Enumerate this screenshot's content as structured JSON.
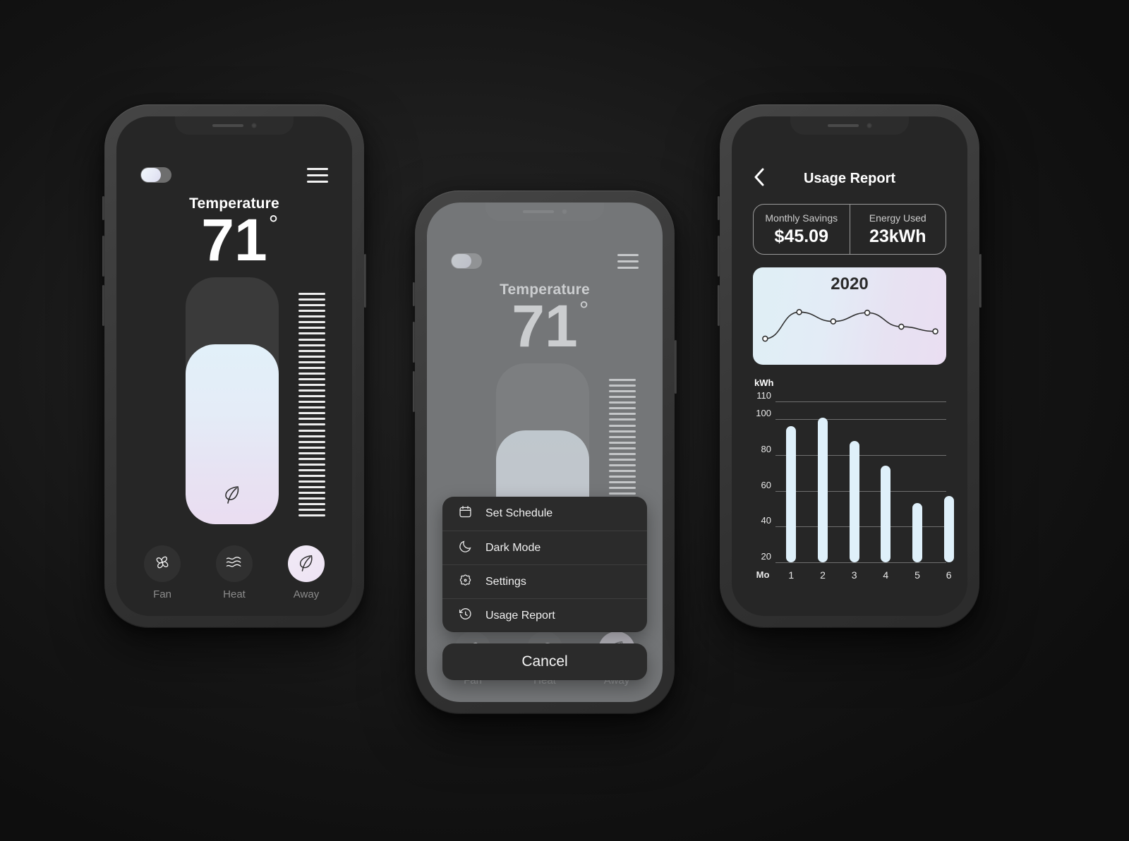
{
  "thermostat": {
    "power_toggle_state": "off",
    "menu_icon": "hamburger-icon",
    "temperature_label": "Temperature",
    "temperature_value": "71",
    "degree_symbol": "°",
    "slider_icon": "leaf-icon",
    "slider_fill_percent": 73,
    "modes": [
      {
        "label": "Fan",
        "icon": "fan-icon",
        "active": false
      },
      {
        "label": "Heat",
        "icon": "waves-icon",
        "active": false
      },
      {
        "label": "Away",
        "icon": "leaf-icon",
        "active": true
      }
    ]
  },
  "action_sheet": {
    "items": [
      {
        "label": "Set Schedule",
        "icon": "calendar-icon"
      },
      {
        "label": "Dark Mode",
        "icon": "moon-icon"
      },
      {
        "label": "Settings",
        "icon": "gear-icon"
      },
      {
        "label": "Usage Report",
        "icon": "history-clock-icon"
      }
    ],
    "cancel_label": "Cancel"
  },
  "usage_report": {
    "back_icon": "chevron-left-icon",
    "title": "Usage Report",
    "stats": [
      {
        "label": "Monthly Savings",
        "value": "$45.09"
      },
      {
        "label": "Energy Used",
        "value": "23kWh"
      }
    ],
    "year_card_title": "2020"
  },
  "colors": {
    "accent_light_blue": "#dff0fa",
    "accent_lavender": "#eadef2",
    "screen_bg": "#262626",
    "phone_frame": "#3a3a3a",
    "sheet_bg": "#2b2b2b",
    "dim_overlay": "#a8acaf"
  },
  "chart_data": [
    {
      "type": "line",
      "title": "2020",
      "x": [
        1,
        2,
        3,
        4,
        5,
        6
      ],
      "values": [
        18,
        58,
        44,
        57,
        36,
        29
      ],
      "ylim": [
        0,
        70
      ],
      "xlabel": "",
      "ylabel": "",
      "grid": false,
      "legend": "none",
      "marker": "circle-open"
    },
    {
      "type": "bar",
      "title": "",
      "ylabel": "kWh",
      "xlabel": "Mo",
      "categories": [
        "1",
        "2",
        "3",
        "4",
        "5",
        "6"
      ],
      "values": [
        96,
        101,
        88,
        74,
        53,
        57
      ],
      "ytick_labels": [
        "20",
        "40",
        "60",
        "80",
        "100",
        "110"
      ],
      "yticks": [
        20,
        40,
        60,
        80,
        100,
        110
      ],
      "ylim": [
        20,
        110
      ],
      "grid": true,
      "legend": "none",
      "bar_color": "#dff0fa"
    }
  ]
}
